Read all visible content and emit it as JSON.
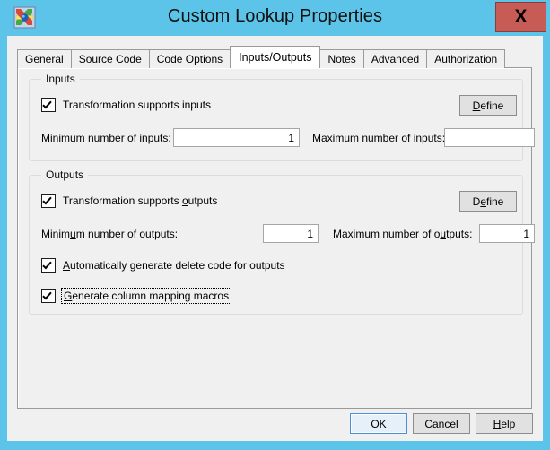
{
  "window": {
    "title": "Custom Lookup Properties",
    "icon": "ssis-transformation-icon",
    "close_label": "X",
    "accent_titlebar_color": "#5bc4e8",
    "close_button_color": "#c75b56",
    "dialog_background": "#f0f0f0"
  },
  "tabs": [
    {
      "label": "General",
      "selected": false
    },
    {
      "label": "Source Code",
      "selected": false
    },
    {
      "label": "Code Options",
      "selected": false
    },
    {
      "label": "Inputs/Outputs",
      "selected": true
    },
    {
      "label": "Notes",
      "selected": false
    },
    {
      "label": "Advanced",
      "selected": false
    },
    {
      "label": "Authorization",
      "selected": false
    }
  ],
  "inputs_group": {
    "title": "Inputs",
    "supports_checkbox": {
      "label": "Transformation supports inputs",
      "checked": true
    },
    "define_button": "Define",
    "min_label_prefix": "",
    "min_label_acc": "M",
    "min_label_rest": "inimum number of inputs:",
    "min_value": "1",
    "max_label_pre": "Ma",
    "max_label_acc": "x",
    "max_label_rest": "imum number of inputs:",
    "max_value": ""
  },
  "outputs_group": {
    "title": "Outputs",
    "supports_checkbox": {
      "label_pre": "Transformation supports ",
      "label_acc": "o",
      "label_post": "utputs",
      "full_label": "Transformation supports outputs",
      "checked": true
    },
    "define_button": "Define",
    "min_label_pre": "Minim",
    "min_label_acc": "u",
    "min_label_post": "m number of outputs:",
    "min_value": "1",
    "max_label_pre": "Maximum number of o",
    "max_label_acc": "u",
    "max_label_post": "tputs:",
    "max_value": "1",
    "auto_delete_checkbox": {
      "label_acc": "A",
      "label_mid": "utomatically ",
      "label_acc2": "g",
      "label_rest": "enerate delete code for outputs",
      "full_label": "Automatically generate delete code for outputs",
      "checked": true
    },
    "mapping_macros_checkbox": {
      "label_acc": "G",
      "label_rest": "enerate column mapping macros",
      "full_label": "Generate column mapping macros",
      "checked": true,
      "focused": true
    }
  },
  "footer": {
    "ok_label": "OK",
    "cancel_label": "Cancel",
    "help_label_acc": "H",
    "help_label_rest": "elp",
    "help_full": "Help"
  }
}
